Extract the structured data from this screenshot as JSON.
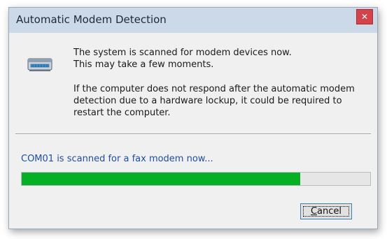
{
  "window": {
    "title": "Automatic Modem Detection"
  },
  "message": {
    "line1": "The system is scanned for modem devices now.",
    "line2": "This may take a few moments.",
    "warning": "If the computer does not respond after the automatic modem detection due to a hardware lockup, it could be required to restart the computer."
  },
  "status": {
    "text": "COM01 is scanned for a fax modem now...",
    "progress_fraction": 0.8
  },
  "buttons": {
    "cancel_access_key": "C",
    "cancel_rest": "ancel"
  },
  "icons": {
    "close": "close-icon",
    "modem": "modem-icon"
  },
  "colors": {
    "progress_fill": "#06b025",
    "status_text": "#1e4ea0",
    "close_button": "#d4434a",
    "titlebar": "#cbd9e8"
  }
}
